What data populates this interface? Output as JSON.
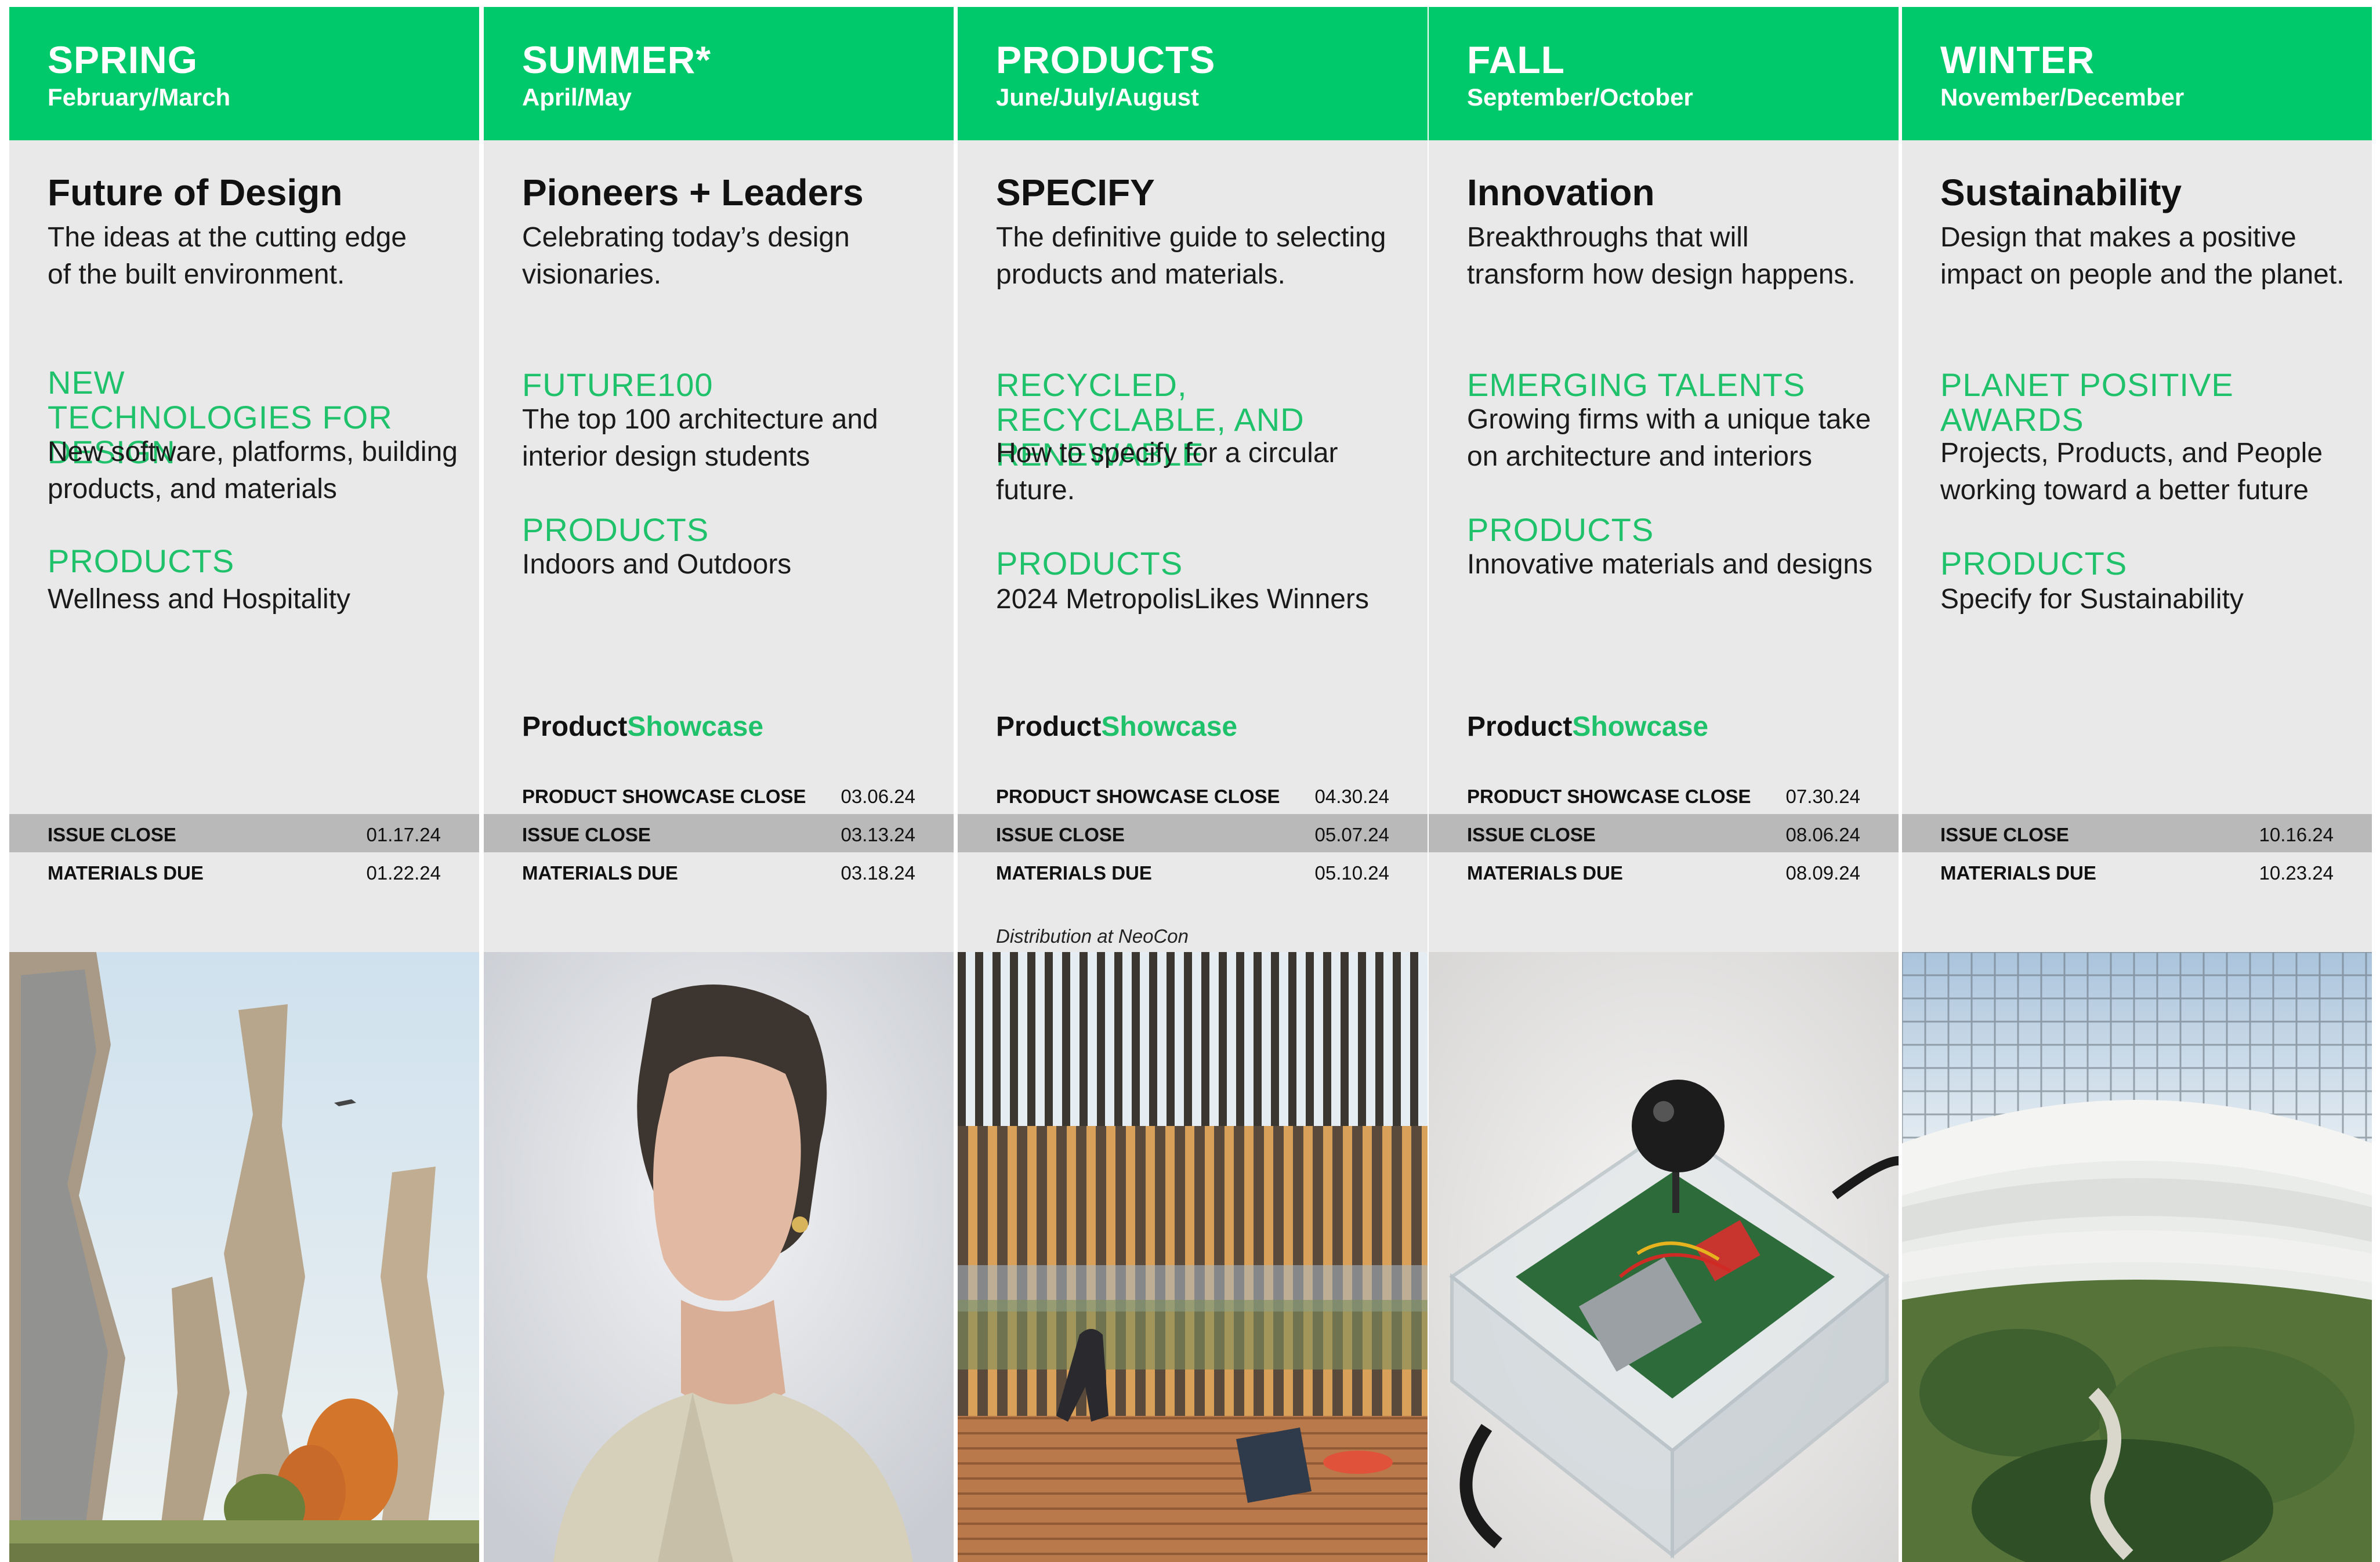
{
  "columns": [
    {
      "season": "SPRING",
      "months": "February/March",
      "theme": "Future of Design",
      "theme_desc": "The ideas at the cutting edge of the built environment.",
      "section1_title": "NEW TECHNOLOGIES FOR DESIGN",
      "section1_desc": "New software, platforms, building products, and materials",
      "section2_title": "PRODUCTS",
      "section2_desc": "Wellness and Hospitality",
      "issue_close_label": "ISSUE CLOSE",
      "issue_close": "01.17.24",
      "materials_due_label": "MATERIALS DUE",
      "materials_due": "01.22.24"
    },
    {
      "season": "SUMMER*",
      "months": "April/May",
      "theme": "Pioneers + Leaders",
      "theme_desc": "Celebrating today’s design visionaries.",
      "section1_title": "FUTURE100",
      "section1_desc": "The top 100 architecture and interior design students",
      "section2_title": "PRODUCTS",
      "section2_desc": "Indoors and Outdoors",
      "showcase_a": "Product",
      "showcase_b": "Showcase",
      "showcase_close_label": "PRODUCT SHOWCASE CLOSE",
      "showcase_close": "03.06.24",
      "issue_close_label": "ISSUE CLOSE",
      "issue_close": "03.13.24",
      "materials_due_label": "MATERIALS DUE",
      "materials_due": "03.18.24"
    },
    {
      "season": "PRODUCTS",
      "months": "June/July/August",
      "theme": "SPECIFY",
      "theme_desc": "The definitive guide to selecting products and materials.",
      "section1_title": "RECYCLED, RECYCLABLE, AND RENEWABLE",
      "section1_desc": "How to specify for a circular future.",
      "section2_title": "PRODUCTS",
      "section2_desc": "2024 MetropolisLikes Winners",
      "showcase_a": "Product",
      "showcase_b": "Showcase",
      "showcase_close_label": "PRODUCT SHOWCASE CLOSE",
      "showcase_close": "04.30.24",
      "issue_close_label": "ISSUE CLOSE",
      "issue_close": "05.07.24",
      "materials_due_label": "MATERIALS DUE",
      "materials_due": "05.10.24",
      "note": "Distribution at NeoCon"
    },
    {
      "season": "FALL",
      "months": "September/October",
      "theme": "Innovation",
      "theme_desc": "Breakthroughs that will transform how design happens.",
      "section1_title": "EMERGING TALENTS",
      "section1_desc": "Growing firms with a unique take on architecture and interiors",
      "section2_title": "PRODUCTS",
      "section2_desc": "Innovative materials and designs",
      "showcase_a": "Product",
      "showcase_b": "Showcase",
      "showcase_close_label": "PRODUCT SHOWCASE CLOSE",
      "showcase_close": "07.30.24",
      "issue_close_label": "ISSUE CLOSE",
      "issue_close": "08.06.24",
      "materials_due_label": "MATERIALS DUE",
      "materials_due": "08.09.24"
    },
    {
      "season": "WINTER",
      "months": "November/December",
      "theme": "Sustainability",
      "theme_desc": "Design that makes a positive impact on people and the planet.",
      "section1_title": "PLANET POSITIVE AWARDS",
      "section1_desc": "Projects, Products, and People working toward a better future",
      "section2_title": "PRODUCTS",
      "section2_desc": "Specify for Sustainability",
      "issue_close_label": "ISSUE CLOSE",
      "issue_close": "10.16.24",
      "materials_due_label": "MATERIALS DUE",
      "materials_due": "10.23.24"
    }
  ],
  "photos": [
    "twisted-towers-photo",
    "woman-portrait-photo",
    "louvered-terrace-photo",
    "acrylic-device-photo",
    "atrium-garden-photo"
  ],
  "colors": {
    "accent": "#00c96b",
    "accent_text": "#1fc26b",
    "panel": "#e9e9e9",
    "shade_row": "#b9b9b9"
  }
}
